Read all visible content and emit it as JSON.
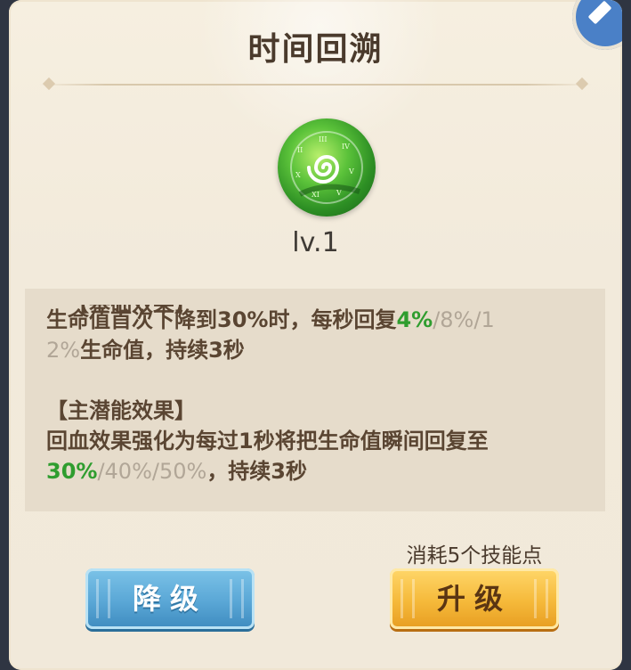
{
  "dialog": {
    "title": "时间回溯",
    "level_label": "lv.1",
    "skill_icon": "green-clock-swirl-orb-icon",
    "edit_icon": "pencil-icon"
  },
  "description": {
    "base_header_partial": "【基础效果】",
    "base_effect_prefix": "生命值首次下降到30%时，每秒回复",
    "base_value_current": "4%",
    "base_value_rest_line1": "/8%/1",
    "base_value_rest_line2": "2%",
    "base_effect_suffix": "生命值，持续3秒",
    "main_header": "【主潜能效果】",
    "main_effect_line1": "回血效果强化为每过1秒将把生命值瞬间回复至",
    "main_value_current": "30%",
    "main_value_rest": "/40%/50%",
    "main_effect_suffix": "，持续3秒"
  },
  "cost_label": "消耗5个技能点",
  "buttons": {
    "downgrade": "降级",
    "upgrade": "升级"
  },
  "colors": {
    "highlight_green": "#2f9d2f",
    "inactive_gray": "#b1a697",
    "downgrade_blue": "#5aa7d6",
    "upgrade_orange": "#f5b93a"
  }
}
